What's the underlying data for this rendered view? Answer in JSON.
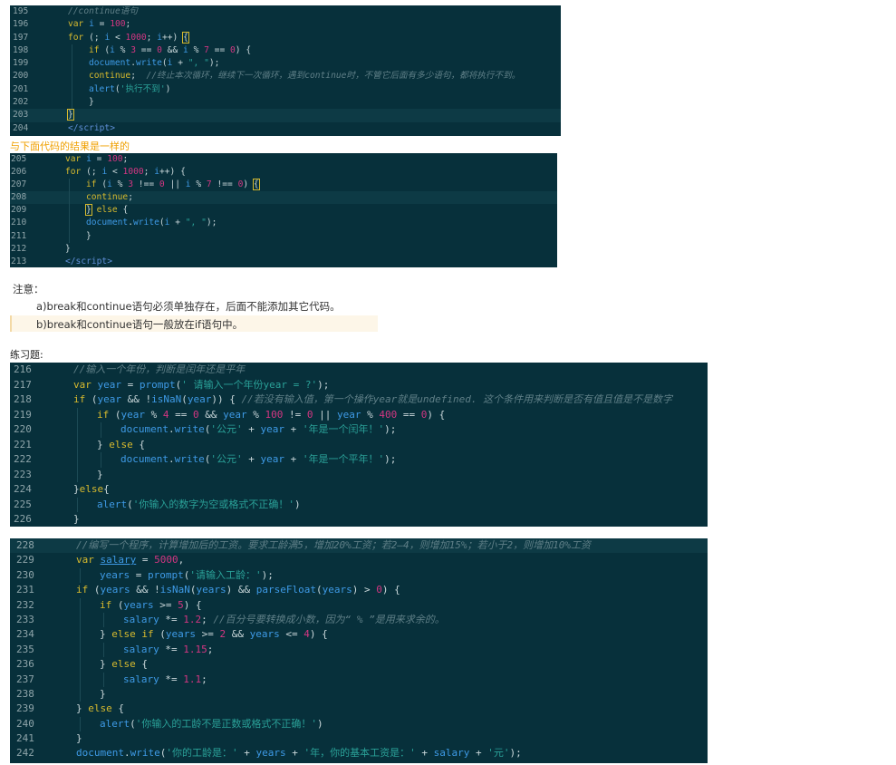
{
  "block1": {
    "lines": [
      {
        "no": "195",
        "indent": 0,
        "html": "<span class='c'>//continue语句</span>"
      },
      {
        "no": "196",
        "indent": 0,
        "html": "<span class='k'>var</span> <span class='v'>i</span> = <span class='n'>100</span>;"
      },
      {
        "no": "197",
        "indent": 0,
        "html": "<span class='k'>for</span> (; <span class='v'>i</span> &lt; <span class='n'>1000</span>; <span class='v'>i</span>++) <span class='box'>{</span>"
      },
      {
        "no": "198",
        "indent": 1,
        "html": "<span class='k'>if</span> (<span class='v'>i</span> % <span class='n'>3</span> == <span class='n'>0</span> &amp;&amp; <span class='v'>i</span> % <span class='n'>7</span> == <span class='n'>0</span>) {"
      },
      {
        "no": "199",
        "indent": 1,
        "html": "<span class='f'>document</span>.<span class='f'>write</span>(<span class='v'>i</span> + <span class='s'>\", \"</span>);"
      },
      {
        "no": "200",
        "indent": 1,
        "html": "<span class='k'>continue</span>;  <span class='c'>//终止本次循环，继续下一次循环，遇到continue时，不管它后面有多少语句，都将执行不到。</span>"
      },
      {
        "no": "201",
        "indent": 1,
        "html": "<span class='f'>alert</span>(<span class='s'>'执行不到'</span>)"
      },
      {
        "no": "202",
        "indent": 1,
        "html": "}"
      },
      {
        "no": "203",
        "indent": 0,
        "html": "<span class='box'>}</span>",
        "hl": true
      },
      {
        "no": "204",
        "indent": 0,
        "html": "<span class='tag'>&lt;/script&gt;</span>"
      }
    ]
  },
  "caption1": "与下面代码的结果是一样的",
  "block2": {
    "lines": [
      {
        "no": "205",
        "indent": 0,
        "html": "<span class='k'>var</span> <span class='v'>i</span> = <span class='n'>100</span>;"
      },
      {
        "no": "206",
        "indent": 0,
        "html": "<span class='k'>for</span> (; <span class='v'>i</span> &lt; <span class='n'>1000</span>; <span class='v'>i</span>++) {"
      },
      {
        "no": "207",
        "indent": 1,
        "html": "<span class='k'>if</span> (<span class='v'>i</span> % <span class='n'>3</span> !== <span class='n'>0</span> || <span class='v'>i</span> % <span class='n'>7</span> !== <span class='n'>0</span>) <span class='box'>{</span>"
      },
      {
        "no": "208",
        "indent": 1,
        "html": "<span class='k'>continue</span>;",
        "hl": true
      },
      {
        "no": "209",
        "indent": 1,
        "html": "<span class='box'>}</span> <span class='k'>else</span> {"
      },
      {
        "no": "210",
        "indent": 1,
        "html": "<span class='f'>document</span>.<span class='f'>write</span>(<span class='v'>i</span> + <span class='s'>\", \"</span>);"
      },
      {
        "no": "211",
        "indent": 1,
        "html": "}"
      },
      {
        "no": "212",
        "indent": 0,
        "html": "}"
      },
      {
        "no": "213",
        "indent": 0,
        "html": "<span class='tag'>&lt;/script&gt;</span>"
      }
    ]
  },
  "note": {
    "title": "注意：",
    "a": "a)break和continue语句必须单独存在，后面不能添加其它代码。",
    "b": "b)break和continue语句一般放在if语句中。"
  },
  "practice_label": "练习题:",
  "block3": {
    "lines": [
      {
        "no": "216",
        "indent": 0,
        "html": "<span class='c'>//输入一个年份，判断是闰年还是平年</span>"
      },
      {
        "no": "217",
        "indent": 0,
        "html": "<span class='k'>var</span> <span class='v'>year</span> = <span class='f'>prompt</span>(<span class='s'>' 请输入一个年份year = ?'</span>);"
      },
      {
        "no": "218",
        "indent": 0,
        "html": "<span class='k'>if</span> (<span class='v'>year</span> &amp;&amp; !<span class='f'>isNaN</span>(<span class='v'>year</span>)) { <span class='c'>//若没有输入值，第一个操作year就是undefined. 这个条件用来判断是否有值且值是不是数字</span>"
      },
      {
        "no": "219",
        "indent": 1,
        "html": "<span class='k'>if</span> (<span class='v'>year</span> % <span class='n'>4</span> == <span class='n'>0</span> &amp;&amp; <span class='v'>year</span> % <span class='n'>100</span> != <span class='n'>0</span> || <span class='v'>year</span> % <span class='n'>400</span> == <span class='n'>0</span>) {"
      },
      {
        "no": "220",
        "indent": 2,
        "html": "<span class='f'>document</span>.<span class='f'>write</span>(<span class='s'>'公元'</span> + <span class='v'>year</span> + <span class='s'>'年是一个闰年！'</span>);"
      },
      {
        "no": "221",
        "indent": 1,
        "html": "} <span class='k'>else</span> {"
      },
      {
        "no": "222",
        "indent": 2,
        "html": "<span class='f'>document</span>.<span class='f'>write</span>(<span class='s'>'公元'</span> + <span class='v'>year</span> + <span class='s'>'年是一个平年！'</span>);"
      },
      {
        "no": "223",
        "indent": 1,
        "html": "}"
      },
      {
        "no": "224",
        "indent": 0,
        "html": "}<span class='k'>else</span>{"
      },
      {
        "no": "225",
        "indent": 1,
        "html": "<span class='f'>alert</span>(<span class='s'>'你输入的数字为空或格式不正确！'</span>)"
      },
      {
        "no": "226",
        "indent": 0,
        "html": "}"
      }
    ]
  },
  "block4": {
    "lines": [
      {
        "no": "228",
        "indent": 0,
        "html": "<span class='c'>//编写一个程序，计算增加后的工资。要求工龄满5，增加20%工资；若2—4，则增加15%；若小于2，则增加10%工资</span>",
        "hl": true
      },
      {
        "no": "229",
        "indent": 0,
        "html": "<span class='k'>var</span> <span class='v' style='text-decoration:underline'>salary</span> = <span class='n'>5000</span>,"
      },
      {
        "no": "230",
        "indent": 1,
        "html": "<span class='v'>years</span> = <span class='f'>prompt</span>(<span class='s'>'请输入工龄：'</span>);"
      },
      {
        "no": "231",
        "indent": 0,
        "html": "<span class='k'>if</span> (<span class='v'>years</span> &amp;&amp; !<span class='f'>isNaN</span>(<span class='v'>years</span>) &amp;&amp; <span class='f'>parseFloat</span>(<span class='v'>years</span>) &gt; <span class='n'>0</span>) {"
      },
      {
        "no": "232",
        "indent": 1,
        "html": "<span class='k'>if</span> (<span class='v'>years</span> &gt;= <span class='n'>5</span>) {"
      },
      {
        "no": "233",
        "indent": 2,
        "html": "<span class='v'>salary</span> *= <span class='n'>1.2</span>; <span class='c'>//百分号要转换成小数，因为“ % ”是用来求余的。</span>"
      },
      {
        "no": "234",
        "indent": 1,
        "html": "} <span class='k'>else if</span> (<span class='v'>years</span> &gt;= <span class='n'>2</span> &amp;&amp; <span class='v'>years</span> &lt;= <span class='n'>4</span>) {"
      },
      {
        "no": "235",
        "indent": 2,
        "html": "<span class='v'>salary</span> *= <span class='n'>1.15</span>;"
      },
      {
        "no": "236",
        "indent": 1,
        "html": "} <span class='k'>else</span> {"
      },
      {
        "no": "237",
        "indent": 2,
        "html": "<span class='v'>salary</span> *= <span class='n'>1.1</span>;"
      },
      {
        "no": "238",
        "indent": 1,
        "html": "}"
      },
      {
        "no": "239",
        "indent": 0,
        "html": "} <span class='k'>else</span> {"
      },
      {
        "no": "240",
        "indent": 1,
        "html": "<span class='f'>alert</span>(<span class='s'>'你输入的工龄不是正数或格式不正确！'</span>)"
      },
      {
        "no": "241",
        "indent": 0,
        "html": "}"
      },
      {
        "no": "242",
        "indent": 0,
        "html": "<span class='f'>document</span>.<span class='f'>write</span>(<span class='s'>'你的工龄是：'</span> + <span class='v'>years</span> + <span class='s'>'年，你的基本工资是：'</span> + <span class='v'>salary</span> + <span class='s'>'元'</span>);"
      }
    ]
  }
}
